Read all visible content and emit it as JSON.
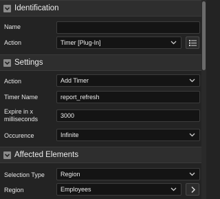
{
  "sections": {
    "identification": {
      "title": "Identification",
      "name_label": "Name",
      "name_value": "",
      "action_label": "Action",
      "action_value": "Timer [Plug-In]"
    },
    "settings": {
      "title": "Settings",
      "action_label": "Action",
      "action_value": "Add Timer",
      "timer_name_label": "Timer Name",
      "timer_name_value": "report_refresh",
      "expire_label_line1": "Expire in x",
      "expire_label_line2": "milliseconds",
      "expire_value": "3000",
      "occurence_label": "Occurence",
      "occurence_value": "Infinite"
    },
    "affected_elements": {
      "title": "Affected Elements",
      "selection_type_label": "Selection Type",
      "selection_type_value": "Region",
      "region_label": "Region",
      "region_value": "Employees"
    }
  },
  "icons": {
    "collapse": "collapse-chevron-icon",
    "dropdown": "chevron-down-icon",
    "list": "list-icon",
    "go": "chevron-right-icon"
  },
  "colors": {
    "background": "#232323",
    "header": "#2e2e2e",
    "field": "#141414",
    "text": "#e6e6e6"
  }
}
